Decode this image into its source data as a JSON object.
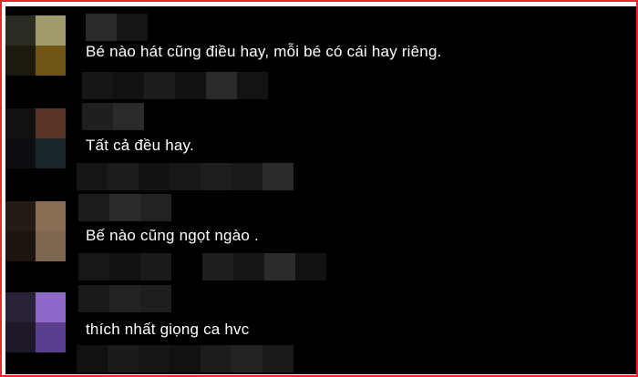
{
  "comments": [
    {
      "text": "Bé nào hát cũng điều hay, mỗi bé có cái hay riêng.",
      "avatar_colors": [
        "#2c2d22",
        "#a09b6c",
        "#1c1a0c",
        "#6e5516"
      ]
    },
    {
      "text": "Tất cả đều hay.",
      "avatar_colors": [
        "#111",
        "#5a3527",
        "#0c0e11",
        "#1b252c"
      ]
    },
    {
      "text": "Bế nào cũng ngọt ngào .",
      "avatar_colors": [
        "#241b14",
        "#8a6d55",
        "#1c140e",
        "#7e6650"
      ]
    },
    {
      "text": "thích nhất giọng ca hvc",
      "avatar_colors": [
        "#2a2238",
        "#8d68c9",
        "#1e1828",
        "#5b3f8f"
      ]
    }
  ],
  "pixelation_colors": [
    "#2a2a2a",
    "#1a1a1a",
    "#222222",
    "#111111",
    "#303030"
  ]
}
